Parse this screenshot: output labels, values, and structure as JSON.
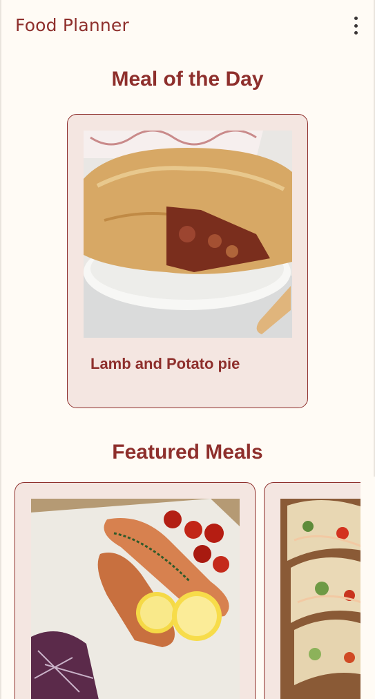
{
  "app_bar": {
    "title": "Food Planner",
    "menu_icon": "more-vert-icon"
  },
  "meal_of_the_day": {
    "heading": "Meal of the Day",
    "meal": {
      "name": "Lamb and Potato pie",
      "image_icon": "lamb-potato-pie-photo"
    }
  },
  "featured": {
    "heading": "Featured Meals",
    "items": [
      {
        "image_icon": "salmon-lemon-photo"
      },
      {
        "image_icon": "tacos-photo"
      }
    ]
  },
  "colors": {
    "primary": "#8E2F2C",
    "background": "#FFFBF5",
    "card": "#F4E6E1"
  }
}
